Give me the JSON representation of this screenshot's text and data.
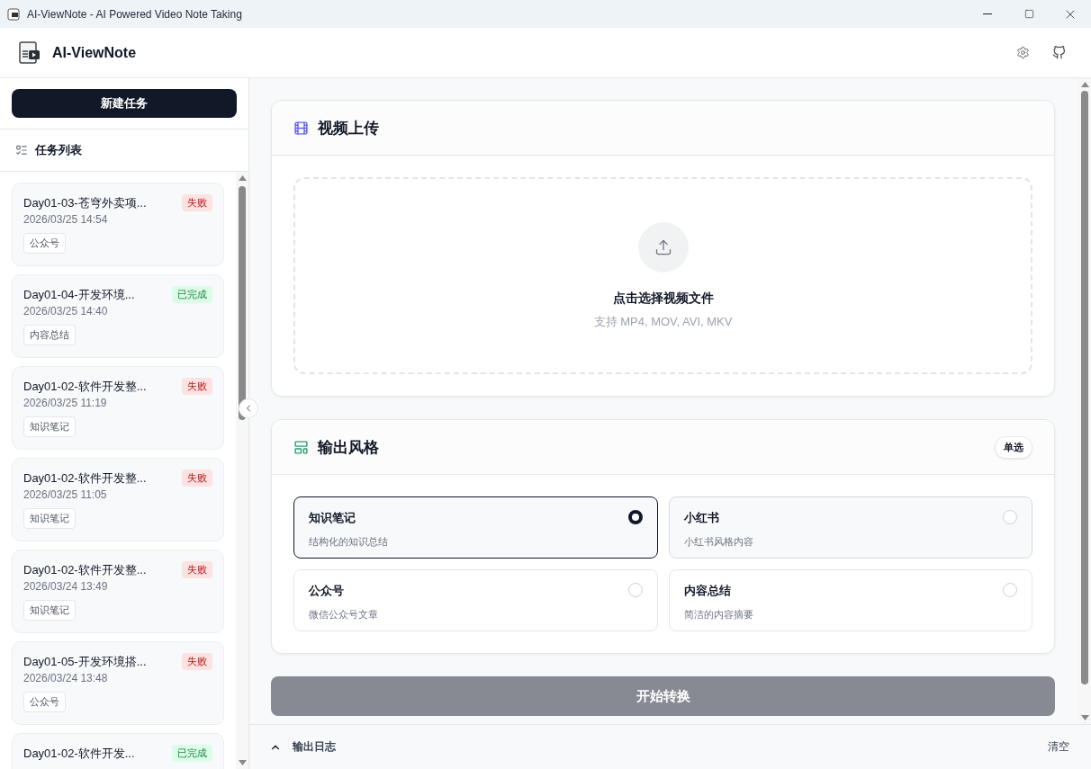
{
  "window": {
    "title": "AI-ViewNote - AI Powered Video Note Taking"
  },
  "header": {
    "app_name": "AI-ViewNote"
  },
  "sidebar": {
    "new_task_button": "新建任务",
    "list_title": "任务列表",
    "tasks": [
      {
        "title": "Day01-03-苍穹外卖项...",
        "date": "2026/03/25 14:54",
        "tag": "公众号",
        "status": {
          "label": "失败",
          "kind": "failed"
        }
      },
      {
        "title": "Day01-04-开发环境...",
        "date": "2026/03/25 14:40",
        "tag": "内容总结",
        "status": {
          "label": "已完成",
          "kind": "done"
        }
      },
      {
        "title": "Day01-02-软件开发整...",
        "date": "2026/03/25 11:19",
        "tag": "知识笔记",
        "status": {
          "label": "失败",
          "kind": "failed"
        }
      },
      {
        "title": "Day01-02-软件开发整...",
        "date": "2026/03/25 11:05",
        "tag": "知识笔记",
        "status": {
          "label": "失败",
          "kind": "failed"
        }
      },
      {
        "title": "Day01-02-软件开发整...",
        "date": "2026/03/24 13:49",
        "tag": "知识笔记",
        "status": {
          "label": "失败",
          "kind": "failed"
        }
      },
      {
        "title": "Day01-05-开发环境搭...",
        "date": "2026/03/24 13:48",
        "tag": "公众号",
        "status": {
          "label": "失败",
          "kind": "failed"
        }
      },
      {
        "title": "Day01-02-软件开发...",
        "status": {
          "label": "已完成",
          "kind": "done"
        }
      }
    ]
  },
  "upload": {
    "title": "视频上传",
    "prompt": "点击选择视频文件",
    "hint": "支持 MP4, MOV, AVI, MKV"
  },
  "style": {
    "title": "输出风格",
    "mode_badge": "单选",
    "options": [
      {
        "label": "知识笔记",
        "description": "结构化的知识总结",
        "selected": true,
        "hovered": false
      },
      {
        "label": "小红书",
        "description": "小红书风格内容",
        "selected": false,
        "hovered": true
      },
      {
        "label": "公众号",
        "description": "微信公众号文章",
        "selected": false,
        "hovered": false
      },
      {
        "label": "内容总结",
        "description": "简洁的内容摘要",
        "selected": false,
        "hovered": false
      }
    ]
  },
  "start_button": {
    "label": "开始转换",
    "disabled": true
  },
  "log": {
    "title": "输出日志",
    "clear_button": "清空",
    "expanded": false
  }
}
